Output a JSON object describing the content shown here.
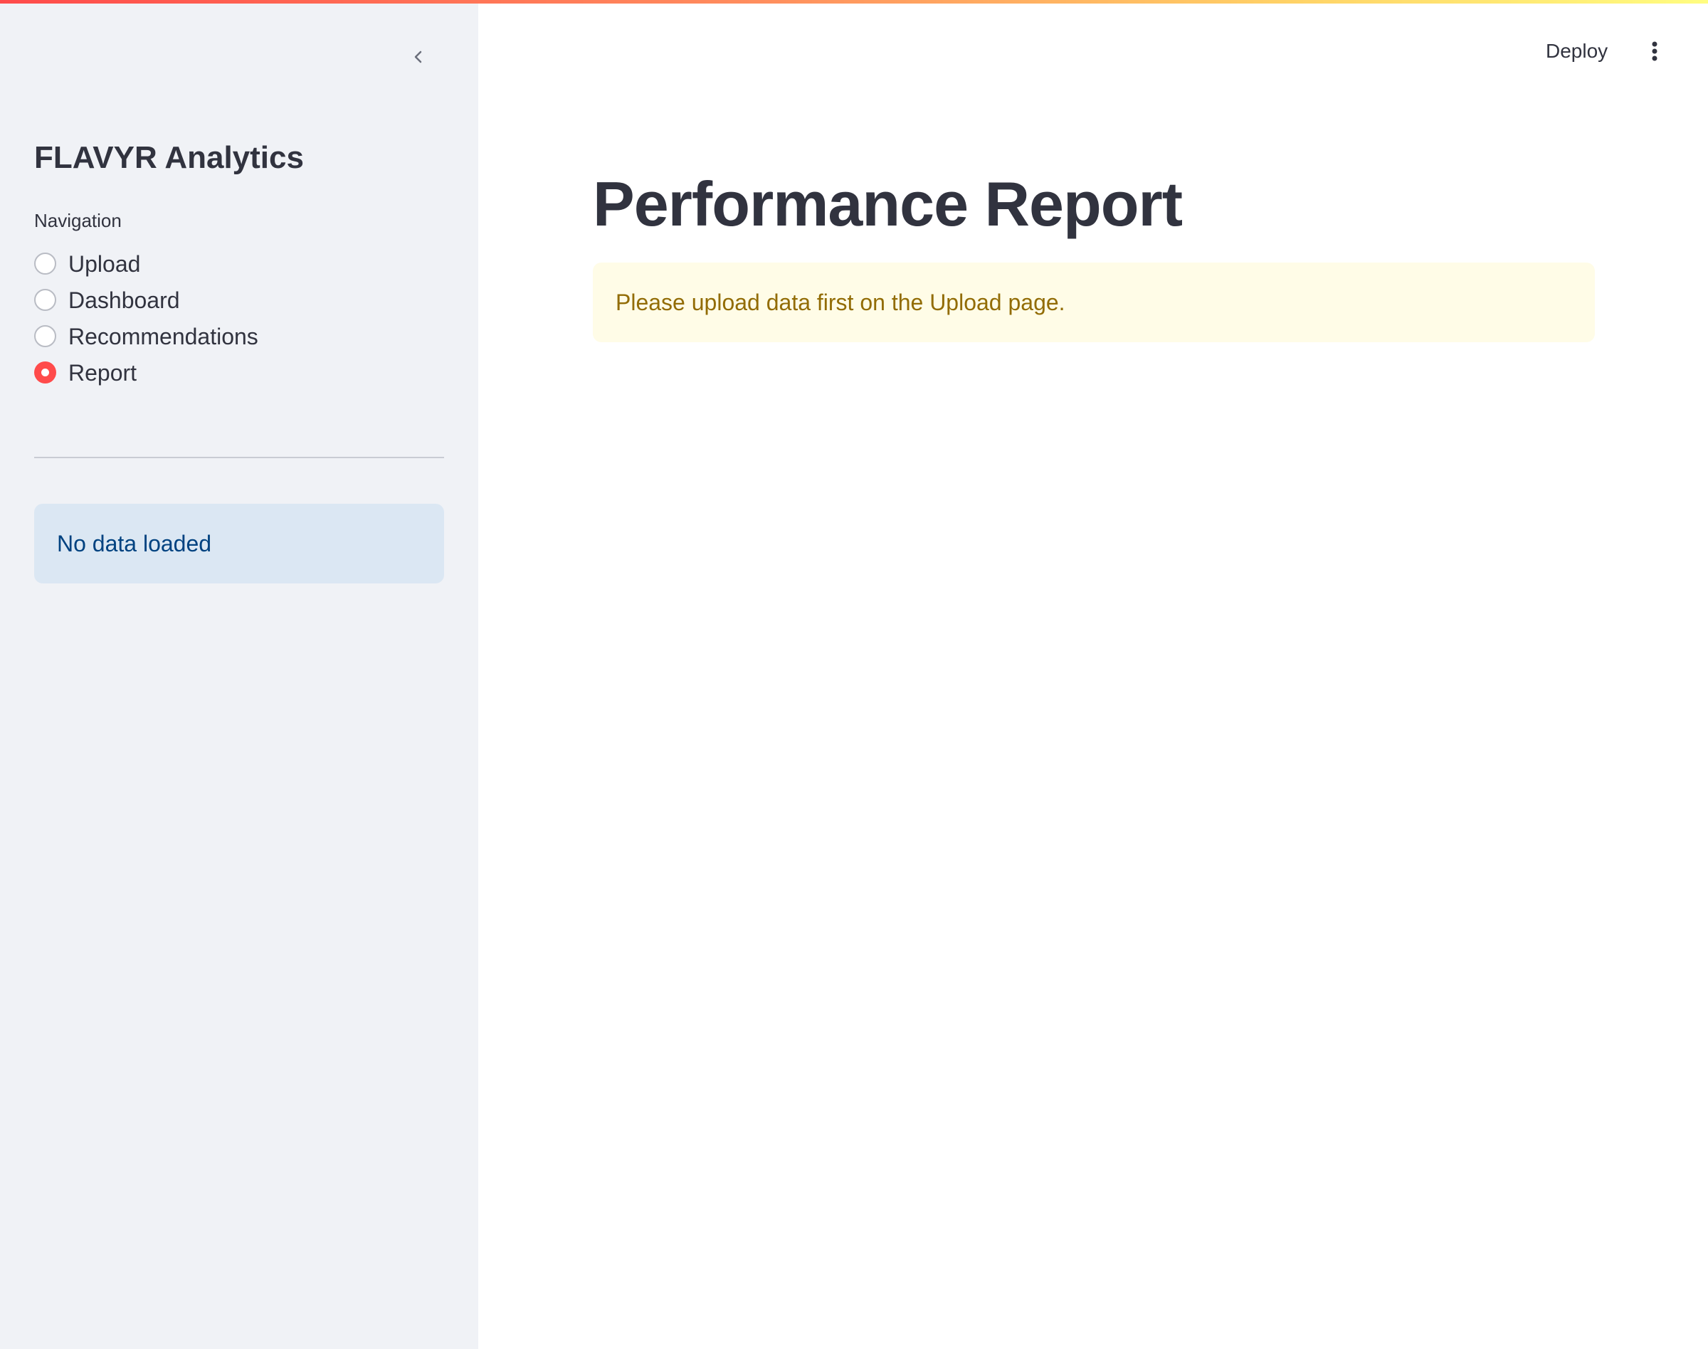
{
  "sidebar": {
    "title": "FLAVYR Analytics",
    "collapse_icon": "chevron-left-icon",
    "navigation": {
      "label": "Navigation",
      "options": [
        {
          "label": "Upload",
          "selected": false
        },
        {
          "label": "Dashboard",
          "selected": false
        },
        {
          "label": "Recommendations",
          "selected": false
        },
        {
          "label": "Report",
          "selected": true
        }
      ]
    },
    "status_info": "No data loaded"
  },
  "header": {
    "deploy_label": "Deploy",
    "menu_icon": "more-vertical-icon"
  },
  "main": {
    "title": "Performance Report",
    "warning": "Please upload data first on the Upload page."
  },
  "colors": {
    "accent": "#ff4b4b",
    "sidebar_bg": "#f0f2f6",
    "info_bg": "#dbe7f3",
    "info_text": "#004280",
    "warning_bg": "#fffce7",
    "warning_text": "#926c05",
    "text": "#31333f"
  }
}
